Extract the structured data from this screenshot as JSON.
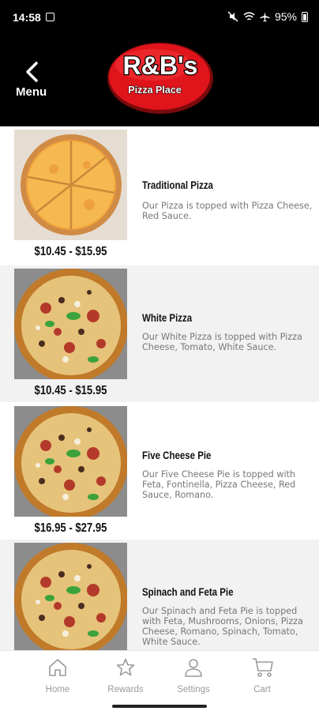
{
  "status": {
    "time": "14:58",
    "battery": "95%"
  },
  "header": {
    "back_label": "Menu",
    "logo_title": "R&B's",
    "logo_subtitle": "Pizza Place"
  },
  "colors": {
    "logo_red": "#e0141b",
    "header_bg": "#000000",
    "nav_gray": "#9a9a9a"
  },
  "menu_items": [
    {
      "title": "Traditional Pizza",
      "description": "Our Pizza is topped with Pizza Cheese, Red Sauce.",
      "price": "$10.45 - $15.95"
    },
    {
      "title": "White Pizza",
      "description": "Our White Pizza is topped with Pizza Cheese, Tomato, White Sauce.",
      "price": "$10.45 - $15.95"
    },
    {
      "title": "Five Cheese Pie",
      "description": "Our Five Cheese Pie is topped with Feta, Fontinella, Pizza Cheese, Red Sauce, Romano.",
      "price": "$16.95 - $27.95"
    },
    {
      "title": "Spinach and Feta Pie",
      "description": "Our Spinach and Feta Pie is topped with Feta, Mushrooms, Onions, Pizza Cheese, Romano, Spinach, Tomato, White Sauce.",
      "price": ""
    }
  ],
  "nav": [
    {
      "label": "Home",
      "icon": "home-icon"
    },
    {
      "label": "Rewards",
      "icon": "star-icon"
    },
    {
      "label": "Settings",
      "icon": "person-icon"
    },
    {
      "label": "Cart",
      "icon": "cart-icon"
    }
  ]
}
